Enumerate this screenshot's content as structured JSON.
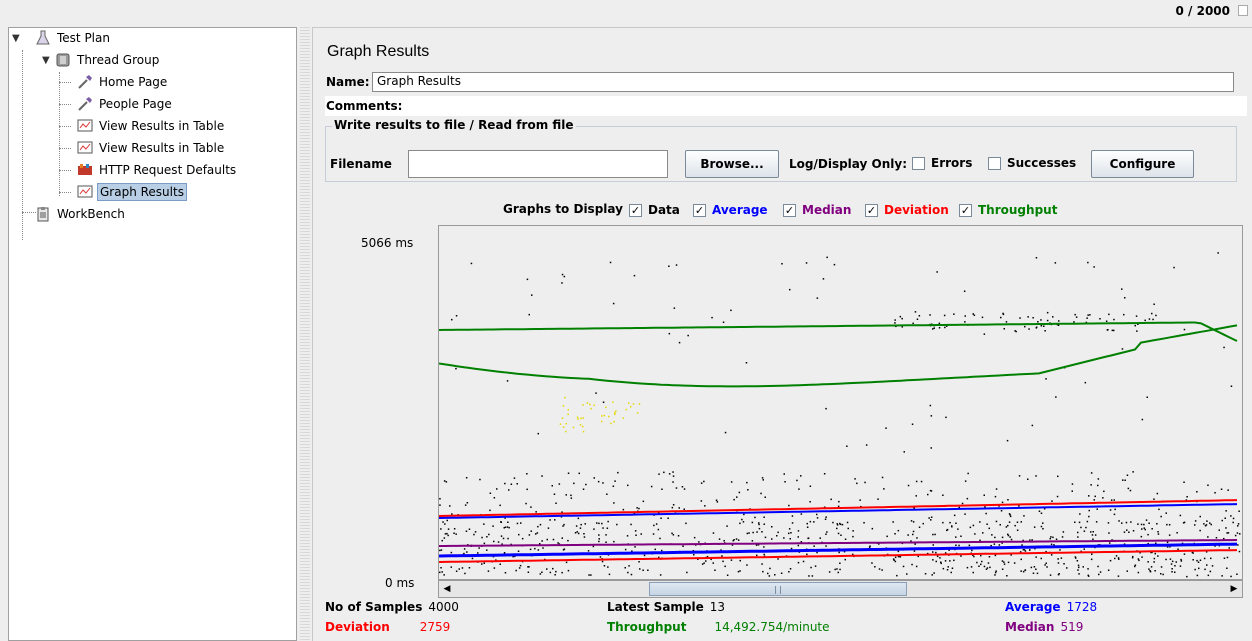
{
  "topbar": {
    "counter": "0 / 2000"
  },
  "tree": {
    "items": [
      {
        "label": "Test Plan"
      },
      {
        "label": "Thread Group"
      },
      {
        "label": "Home Page"
      },
      {
        "label": "People Page"
      },
      {
        "label": "View Results in Table"
      },
      {
        "label": "View Results in Table"
      },
      {
        "label": "HTTP Request Defaults"
      },
      {
        "label": "Graph Results"
      },
      {
        "label": "WorkBench"
      }
    ]
  },
  "panel": {
    "title": "Graph Results",
    "name_label": "Name:",
    "name_value": "Graph Results",
    "comments_label": "Comments:",
    "file_group_title": "Write results to file / Read from file",
    "filename_label": "Filename",
    "filename_value": "",
    "browse_label": "Browse...",
    "logdisplay_label": "Log/Display Only:",
    "errors_label": "Errors",
    "successes_label": "Successes",
    "configure_label": "Configure"
  },
  "graphs": {
    "label": "Graphs to Display",
    "options": [
      {
        "label": "Data",
        "color": "#000000",
        "checked": true
      },
      {
        "label": "Average",
        "color": "#0000ff",
        "checked": true
      },
      {
        "label": "Median",
        "color": "#800080",
        "checked": true
      },
      {
        "label": "Deviation",
        "color": "#ff0000",
        "checked": true
      },
      {
        "label": "Throughput",
        "color": "#008000",
        "checked": true
      }
    ],
    "y_max": "5066 ms",
    "y_min": "0 ms"
  },
  "stats": {
    "samples_label": "No of Samples",
    "samples_value": "4000",
    "latest_label": "Latest Sample",
    "latest_value": "13",
    "average_label": "Average",
    "average_value": "1728",
    "deviation_label": "Deviation",
    "deviation_value": "2759",
    "throughput_label": "Throughput",
    "throughput_value": "14,492.754/minute",
    "median_label": "Median",
    "median_value": "519"
  },
  "colors": {
    "data": "#000000",
    "average": "#0000ff",
    "median": "#800080",
    "deviation": "#ff0000",
    "throughput": "#008000",
    "selection": "#b8cfe5"
  }
}
